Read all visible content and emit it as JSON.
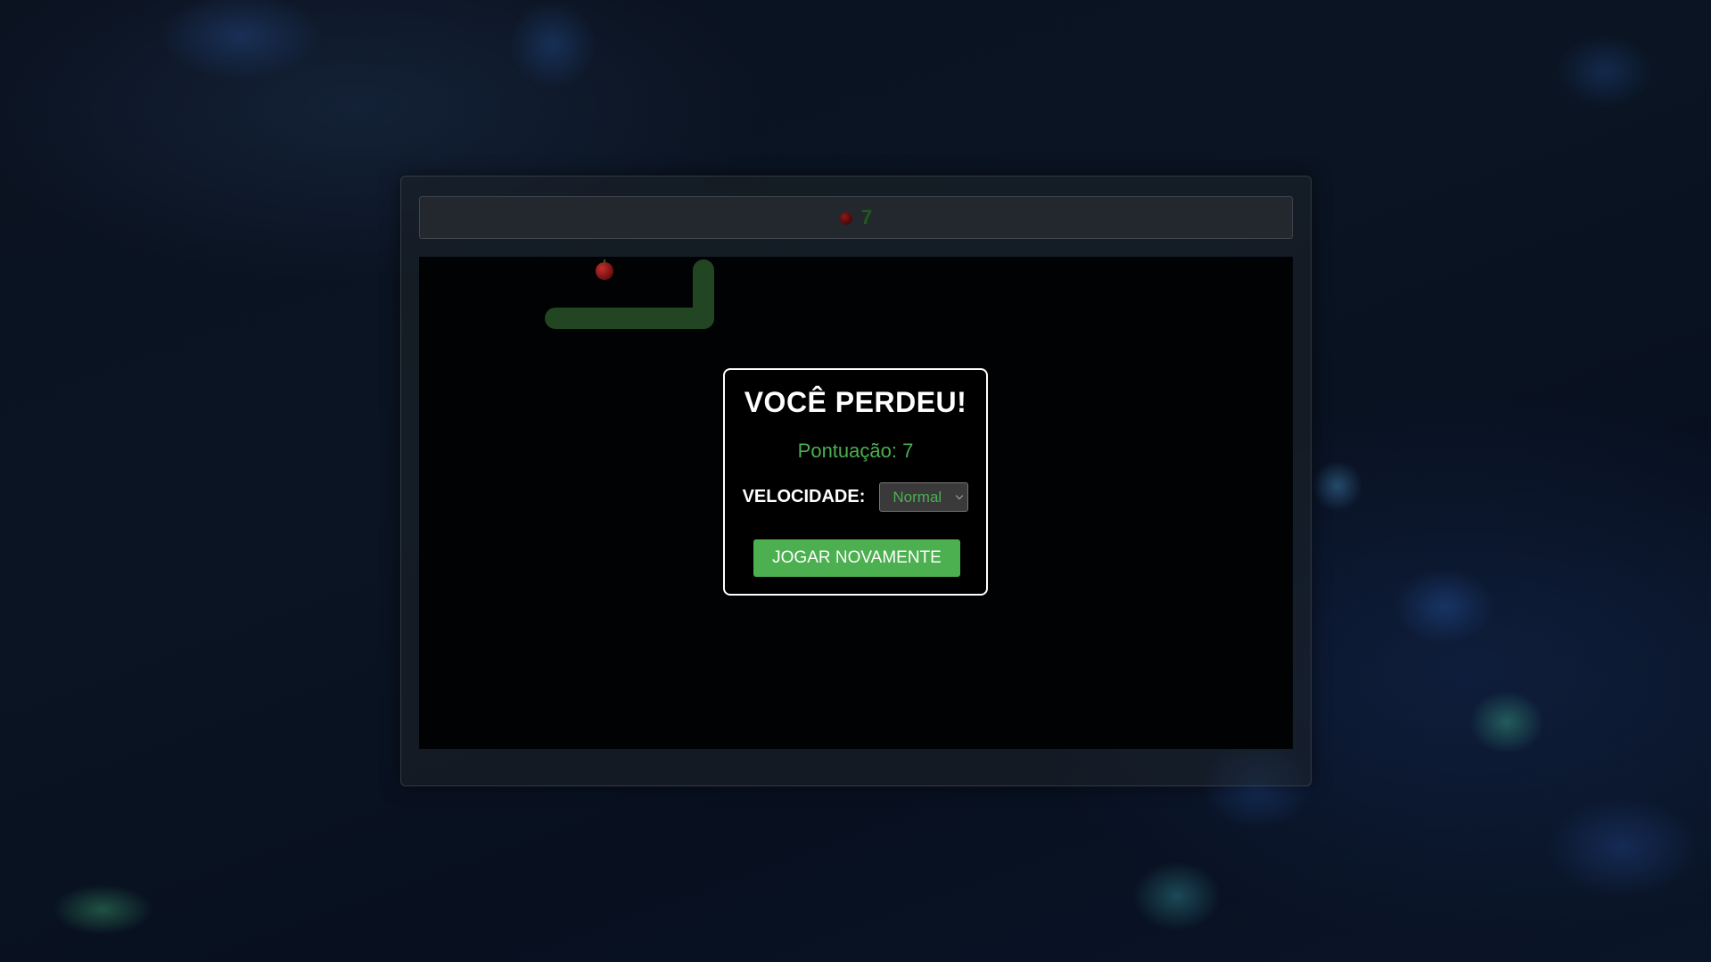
{
  "hud": {
    "apple_icon": "apple-icon",
    "score": "7"
  },
  "board": {
    "background": "#000204",
    "snake_color": "#224622",
    "food_icon": "apple-icon"
  },
  "game_over": {
    "title": "VOCÊ PERDEU!",
    "final_score": "Pontuação: 7",
    "speed_label": "VELOCIDADE:",
    "speed_selected": "Normal",
    "play_again_label": "JOGAR NOVAMENTE"
  },
  "colors": {
    "accent": "#4caf50",
    "modal_border": "#ffffff",
    "food": "#c23030"
  }
}
